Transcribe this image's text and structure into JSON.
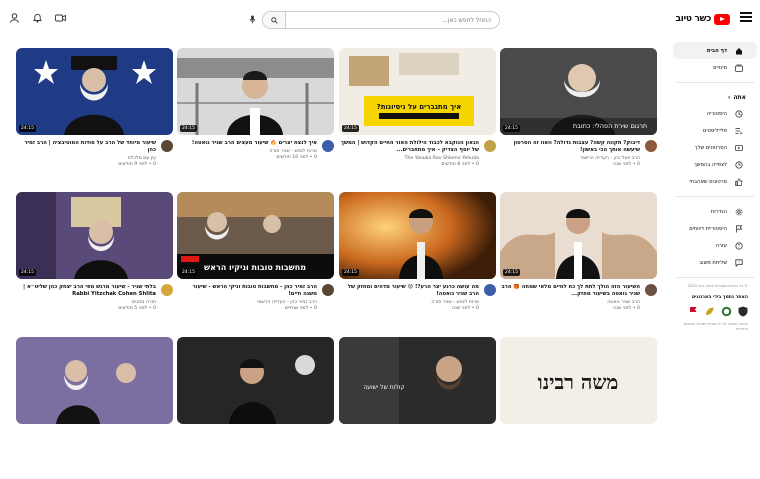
{
  "header": {
    "logo_text": "כשר טיוב",
    "search_placeholder": "התחל לחפש כאן..."
  },
  "icons": {
    "menu": "hamburger-menu-icon",
    "search": "search-icon",
    "mic": "microphone-icon",
    "upload": "video-camera-icon",
    "notifications": "bell-icon",
    "account": "user-icon"
  },
  "sidebar": {
    "primary": [
      {
        "label": "דף הבית",
        "active": true
      },
      {
        "label": "מינויים",
        "active": false
      }
    ],
    "you_header": "אתה",
    "you_items": [
      {
        "label": "היסטוריה"
      },
      {
        "label": "פלייליסטים"
      },
      {
        "label": "הסרטונים שלך"
      },
      {
        "label": "לצפייה בהמשך"
      },
      {
        "label": "סרטונים שאהבתי"
      }
    ],
    "more_items": [
      {
        "label": "הגדרות"
      },
      {
        "label": "היסטוריית דיווחים"
      },
      {
        "label": "עזרה"
      },
      {
        "label": "שליחת משוב"
      }
    ],
    "footer": "© כל הזכויות שמורות לכשר טיוב 2024",
    "promo_title": "האתר נתמך בידי הארגונים",
    "promo_text": "האתר מופעל על ידי אגודת ישראל והגופים החרדים"
  },
  "videos": [
    {
      "title": "דיבוק? תקווה קשה? עצבות גדולה? וואוו זה הסרטון שיעשה אותך הכי באשון!",
      "channel": "הרב יואל כהן - העדייה הרשמי",
      "stats": "0 • לפני שנה",
      "duration": "24:15",
      "thumb_caption": "תרגום שירת הפהלי: כתובת"
    },
    {
      "title": "הגאון הנוקבא לכבוד הילולת האור החיים הקדוש | המשך של יוסף הצדיק – איך מתחברים...",
      "channel": "The Yanuka Rav Shlomo Yehuda",
      "stats": "0 • לפני 8 חודשים",
      "duration": "24:15",
      "thumb_caption": "איך מתגברים על ניסיונות?"
    },
    {
      "title": "איך לנצח יצרים 🔥 שיעור מעצים הרב שניר גואטה!",
      "channel": "מרות לנפש - שניר תורה",
      "stats": "0 • לפני 10 חודשים",
      "duration": "24:15",
      "thumb_caption": ""
    },
    {
      "title": "שיעור מיוחד של הרב על סודות המוטיבציה | הרב זמיר כהן",
      "channel": "עין עם מלכלפ",
      "stats": "0 • לפני 9 חודשים",
      "duration": "24:15",
      "thumb_caption": ""
    },
    {
      "title": "השיעור הזה הולך לתת לך כח לחיים מלאי שמחה 🎁 הרב שניר גואטה בשיעור מחזק...",
      "channel": "הרב שניר גואטה",
      "stats": "0 • לפני שנה",
      "duration": "24:15",
      "thumb_caption": ""
    },
    {
      "title": "מה עושה כרגע יצר הרע?! 😡 שיעור מדהים ומחזק של הרב שניר גואטה!",
      "channel": "מרות לנפש - שניר תורה",
      "stats": "0 • לפני שנה",
      "duration": "24:15",
      "thumb_caption": ""
    },
    {
      "title": "הרב זמיר כהן - מחשבות טובות וניקי הראש - שיעור משנה חיים!",
      "channel": "הרב זמיר כהן - העדייה הרשמי",
      "stats": "0 • לפני שנתיים",
      "duration": "24:15",
      "thumb_caption": "מחשבות טובות וניקיו הראש"
    },
    {
      "title": "בלתי שניר - שיעור מרגש מפי הרב יצחק כהן שליט״א | Rabbi Yitzchak Cohen Shlita",
      "channel": "תורה מחנים",
      "stats": "0 • לפני 5 חודשים",
      "duration": "24:15",
      "thumb_caption": ""
    },
    {
      "title": "",
      "channel": "",
      "stats": "",
      "duration": "",
      "thumb_caption": "משה רבינו"
    },
    {
      "title": "",
      "channel": "",
      "stats": "",
      "duration": "",
      "thumb_caption": "קולות של ישועה"
    },
    {
      "title": "",
      "channel": "",
      "stats": "",
      "duration": "",
      "thumb_caption": ""
    },
    {
      "title": "",
      "channel": "",
      "stats": "",
      "duration": "",
      "thumb_caption": ""
    }
  ],
  "colors": {
    "brand_red": "#ff0000",
    "text": "#0f0f0f",
    "meta_text": "#606060"
  }
}
